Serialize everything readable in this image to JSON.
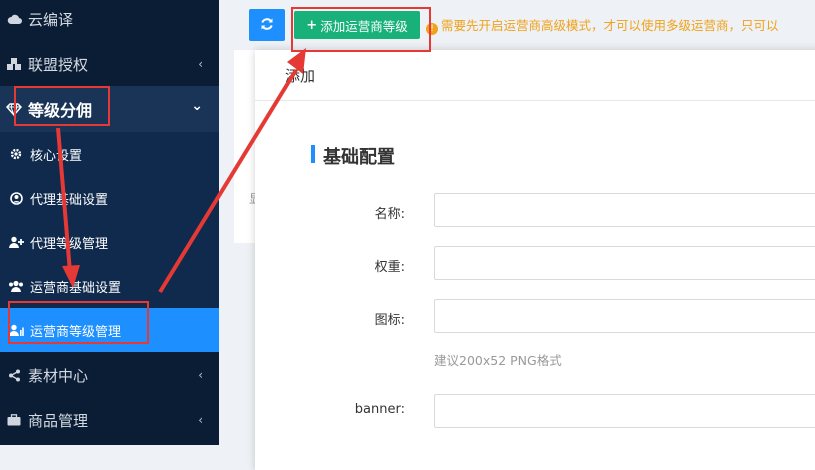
{
  "sidebar": {
    "items": [
      {
        "label": "云编译",
        "icon": "cloud-icon",
        "chevron": ""
      },
      {
        "label": "联盟授权",
        "icon": "cubes-icon",
        "chevron": "‹"
      },
      {
        "label": "等级分佣",
        "icon": "diamond-icon",
        "chevron": "⌄"
      },
      {
        "label": "核心设置",
        "icon": "gear-icon",
        "chevron": ""
      },
      {
        "label": "代理基础设置",
        "icon": "user-circle-icon",
        "chevron": ""
      },
      {
        "label": "代理等级管理",
        "icon": "user-plus-icon",
        "chevron": ""
      },
      {
        "label": "运营商基础设置",
        "icon": "users-icon",
        "chevron": ""
      },
      {
        "label": "运营商等级管理",
        "icon": "user-level-icon",
        "chevron": ""
      },
      {
        "label": "素材中心",
        "icon": "share-icon",
        "chevron": "‹"
      },
      {
        "label": "商品管理",
        "icon": "briefcase-icon",
        "chevron": "‹"
      }
    ]
  },
  "toolbar": {
    "refresh_icon": "refresh-icon",
    "add_label": "添加运营商等级",
    "add_icon": "plus-icon",
    "notice": "需要先开启运营商高级模式，才可以使用多级运营商，只可以"
  },
  "background_card": {
    "stub": "显"
  },
  "modal": {
    "title": "添加",
    "section_title": "基础配置",
    "fields": [
      {
        "label": "名称:",
        "value": ""
      },
      {
        "label": "权重:",
        "value": ""
      },
      {
        "label": "图标:",
        "value": ""
      },
      {
        "label": "banner:",
        "value": ""
      }
    ],
    "icon_hint": "建议200x52 PNG格式"
  },
  "colors": {
    "sidebar_bg": "#0b1d35",
    "sidebar_active": "#1e8fff",
    "add_button": "#18b17a",
    "refresh_button": "#1e8fff",
    "notice_text": "#f0a21a",
    "annotation": "#e53935"
  }
}
